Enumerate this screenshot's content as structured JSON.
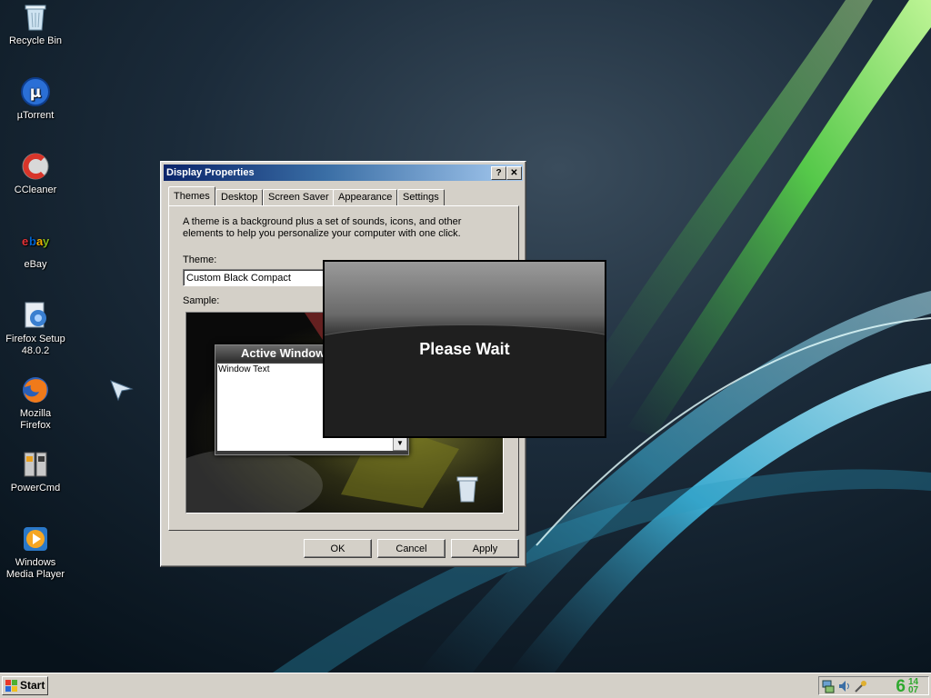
{
  "desktop": {
    "icons": [
      {
        "label": "Recycle Bin",
        "icon": "recycle-bin-icon"
      },
      {
        "label": "µTorrent",
        "icon": "utorrent-icon"
      },
      {
        "label": "CCleaner",
        "icon": "ccleaner-icon"
      },
      {
        "label": "eBay",
        "icon": "ebay-icon"
      },
      {
        "label": "Firefox Setup\n48.0.2",
        "icon": "firefox-setup-icon"
      },
      {
        "label": "Mozilla\nFirefox",
        "icon": "firefox-icon"
      },
      {
        "label": "PowerCmd",
        "icon": "powercmd-icon"
      },
      {
        "label": "Windows\nMedia Player",
        "icon": "media-player-icon"
      }
    ]
  },
  "dialog": {
    "title": "Display Properties",
    "help_glyph": "?",
    "close_glyph": "✕",
    "tabs": [
      "Themes",
      "Desktop",
      "Screen Saver",
      "Appearance",
      "Settings"
    ],
    "active_tab": "Themes",
    "description": "A theme is a background plus a set of sounds, icons, and other elements to help you personalize your computer with one click.",
    "theme_label": "Theme:",
    "theme_value": "Custom Black Compact",
    "sample_label": "Sample:",
    "sample_window_title": "Active Window",
    "sample_window_text": "Window Text",
    "buttons": {
      "ok": "OK",
      "cancel": "Cancel",
      "apply": "Apply"
    }
  },
  "overlay": {
    "text": "Please Wait"
  },
  "taskbar": {
    "start_label": "Start",
    "clock_hour": "6",
    "clock_minutes": "14\n07"
  }
}
